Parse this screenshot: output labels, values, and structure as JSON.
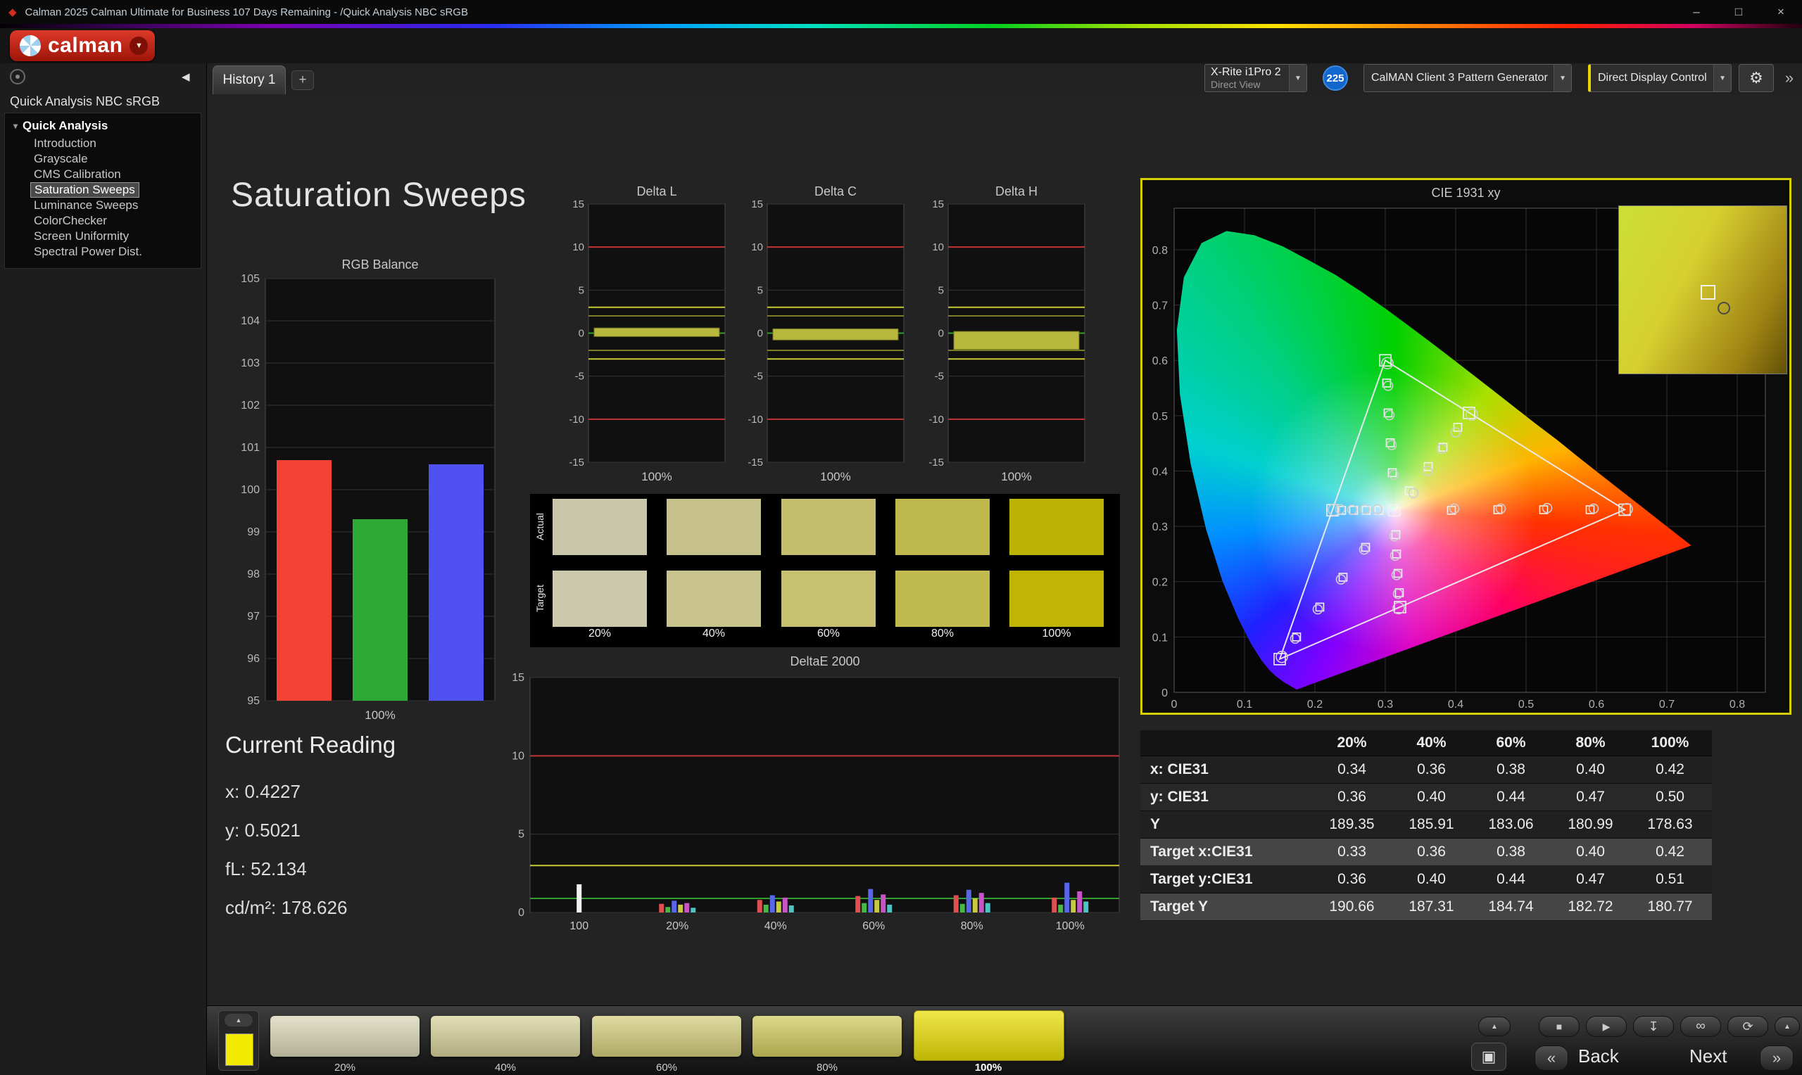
{
  "titlebar": {
    "title": "Calman 2025 Calman Ultimate for Business 107 Days Remaining  - /Quick Analysis NBC sRGB"
  },
  "icons": {
    "app": "◆",
    "minimize": "–",
    "maximize": "□",
    "close": "×",
    "dropdown": "▼",
    "plus": "+",
    "collapse_left": "◀",
    "expand_arrow": "▾",
    "gear": "⚙",
    "double_chevron_right": "»",
    "up_chevron": "▲",
    "stop": "■",
    "play": "▶",
    "save": "↧",
    "infinity": "∞",
    "loop": "⟳",
    "pip": "▣",
    "back_chevron": "«",
    "next_chevron": "»"
  },
  "chrome": {
    "logo_text": "calman",
    "tab": "History 1",
    "meter": {
      "line1": "X-Rite i1Pro 2",
      "line2": "Direct View"
    },
    "badge": "225",
    "generator": "CalMAN Client 3 Pattern Generator",
    "display_control": "Direct Display Control"
  },
  "sidebar": {
    "header": "Quick Analysis NBC sRGB",
    "root": "Quick Analysis",
    "selected": "Saturation Sweeps",
    "items": [
      "Introduction",
      "Grayscale",
      "CMS Calibration",
      "Saturation Sweeps",
      "Luminance Sweeps",
      "ColorChecker",
      "Screen Uniformity",
      "Spectral Power Dist."
    ]
  },
  "page": {
    "title": "Saturation Sweeps"
  },
  "current_reading": {
    "title": "Current Reading",
    "lines": [
      "x: 0.4227",
      "y: 0.5021",
      "fL: 52.134",
      "cd/m²: 178.626"
    ]
  },
  "swatch_table": {
    "row_labels": [
      "Actual",
      "Target"
    ],
    "col_labels": [
      "20%",
      "40%",
      "60%",
      "80%",
      "100%"
    ],
    "actual_colors": [
      "#c9c6a9",
      "#c7c28c",
      "#c4be6e",
      "#bfb84c",
      "#bdb306"
    ],
    "target_colors": [
      "#cbc8ab",
      "#c9c48e",
      "#c6c070",
      "#c1ba4e",
      "#c0b505"
    ]
  },
  "results_table": {
    "col_headers": [
      "20%",
      "40%",
      "60%",
      "80%",
      "100%"
    ],
    "row_colors": [
      "#202020",
      "#282828",
      "#202020",
      "#454545",
      "#202020",
      "#454545"
    ],
    "rows": [
      {
        "label": "x: CIE31",
        "values": [
          "0.34",
          "0.36",
          "0.38",
          "0.40",
          "0.42"
        ]
      },
      {
        "label": "y: CIE31",
        "values": [
          "0.36",
          "0.40",
          "0.44",
          "0.47",
          "0.50"
        ]
      },
      {
        "label": "Y",
        "values": [
          "189.35",
          "185.91",
          "183.06",
          "180.99",
          "178.63"
        ]
      },
      {
        "label": "Target x:CIE31",
        "values": [
          "0.33",
          "0.36",
          "0.38",
          "0.40",
          "0.42"
        ]
      },
      {
        "label": "Target y:CIE31",
        "values": [
          "0.36",
          "0.40",
          "0.44",
          "0.47",
          "0.51"
        ]
      },
      {
        "label": "Target Y",
        "values": [
          "190.66",
          "187.31",
          "184.74",
          "182.72",
          "180.77"
        ]
      }
    ]
  },
  "bottom_bar": {
    "back": "Back",
    "next": "Next",
    "mini_swatch_color": "#f2ea00",
    "swatches": [
      {
        "label": "20%",
        "color": "#d9d6b6",
        "selected": false
      },
      {
        "label": "40%",
        "color": "#d7d29b",
        "selected": false
      },
      {
        "label": "60%",
        "color": "#d4ce7d",
        "selected": false
      },
      {
        "label": "80%",
        "color": "#d1ca5d",
        "selected": false
      },
      {
        "label": "100%",
        "color": "#e9dd05",
        "selected": true
      }
    ]
  },
  "chart_data": [
    {
      "id": "rgb_balance",
      "type": "bar",
      "title": "RGB Balance",
      "categories": [
        "Red",
        "Green",
        "Blue"
      ],
      "values": [
        100.7,
        99.3,
        100.6
      ],
      "colors": [
        "#f44336",
        "#2daa35",
        "#4f52f0"
      ],
      "ylim": [
        95,
        105
      ],
      "xlabel": "100%"
    },
    {
      "id": "delta_l",
      "type": "bar",
      "title": "Delta L",
      "xlabel": "100%",
      "ylim": [
        -15,
        15
      ],
      "bar": [
        0.6,
        -0.4
      ],
      "bar_color": "#b8b83e",
      "ref_lines": [
        [
          10,
          "#c23535"
        ],
        [
          -10,
          "#c23535"
        ],
        [
          3,
          "#c9c938"
        ],
        [
          -3,
          "#c9c938"
        ],
        [
          2,
          "#7d7d26"
        ],
        [
          -2,
          "#7d7d26"
        ],
        [
          0,
          "#2f9f2f"
        ]
      ]
    },
    {
      "id": "delta_c",
      "type": "bar",
      "title": "Delta C",
      "xlabel": "100%",
      "ylim": [
        -15,
        15
      ],
      "bar": [
        0.5,
        -0.8
      ],
      "bar_color": "#b8b83e",
      "ref_lines": [
        [
          10,
          "#c23535"
        ],
        [
          -10,
          "#c23535"
        ],
        [
          3,
          "#c9c938"
        ],
        [
          -3,
          "#c9c938"
        ],
        [
          2,
          "#7d7d26"
        ],
        [
          -2,
          "#7d7d26"
        ],
        [
          0,
          "#2f9f2f"
        ]
      ]
    },
    {
      "id": "delta_h",
      "type": "bar",
      "title": "Delta H",
      "xlabel": "100%",
      "ylim": [
        -15,
        15
      ],
      "bar": [
        0.2,
        -1.9
      ],
      "bar_color": "#b8b83e",
      "ref_lines": [
        [
          10,
          "#c23535"
        ],
        [
          -10,
          "#c23535"
        ],
        [
          3,
          "#c9c938"
        ],
        [
          -3,
          "#c9c938"
        ],
        [
          2,
          "#7d7d26"
        ],
        [
          -2,
          "#7d7d26"
        ],
        [
          0,
          "#2f9f2f"
        ]
      ]
    },
    {
      "id": "deltae",
      "type": "bar",
      "title": "DeltaE 2000",
      "ylim": [
        0,
        15
      ],
      "yticks": [
        0,
        5,
        10,
        15
      ],
      "ref_lines": [
        [
          10,
          "#c23535"
        ],
        [
          3,
          "#c9c938"
        ],
        [
          0.9,
          "#2f9f2f"
        ]
      ],
      "groups": [
        {
          "label": "100",
          "bars": [
            [
              "#f2f2f2",
              1.8
            ]
          ]
        },
        {
          "label": "20%",
          "bars": [
            [
              "#e05050",
              0.55
            ],
            [
              "#46b846",
              0.35
            ],
            [
              "#5866e8",
              0.75
            ],
            [
              "#c9c93f",
              0.5
            ],
            [
              "#c855c8",
              0.6
            ],
            [
              "#4fc3c3",
              0.3
            ]
          ]
        },
        {
          "label": "40%",
          "bars": [
            [
              "#e05050",
              0.8
            ],
            [
              "#46b846",
              0.5
            ],
            [
              "#5866e8",
              1.1
            ],
            [
              "#c9c93f",
              0.7
            ],
            [
              "#c855c8",
              0.95
            ],
            [
              "#4fc3c3",
              0.45
            ]
          ]
        },
        {
          "label": "60%",
          "bars": [
            [
              "#e05050",
              1.05
            ],
            [
              "#46b846",
              0.6
            ],
            [
              "#5866e8",
              1.5
            ],
            [
              "#c9c93f",
              0.8
            ],
            [
              "#c855c8",
              1.15
            ],
            [
              "#4fc3c3",
              0.5
            ]
          ]
        },
        {
          "label": "80%",
          "bars": [
            [
              "#e05050",
              1.1
            ],
            [
              "#46b846",
              0.55
            ],
            [
              "#5866e8",
              1.45
            ],
            [
              "#c9c93f",
              0.9
            ],
            [
              "#c855c8",
              1.25
            ],
            [
              "#4fc3c3",
              0.6
            ]
          ]
        },
        {
          "label": "100%",
          "bars": [
            [
              "#e05050",
              0.95
            ],
            [
              "#46b846",
              0.5
            ],
            [
              "#5866e8",
              1.9
            ],
            [
              "#c9c93f",
              0.8
            ],
            [
              "#c855c8",
              1.35
            ],
            [
              "#4fc3c3",
              0.7
            ]
          ]
        }
      ]
    },
    {
      "id": "cie",
      "type": "scatter",
      "title": "CIE 1931 xy",
      "xlim": [
        0,
        0.84
      ],
      "ylim": [
        0,
        0.875
      ],
      "xticks": [
        0,
        0.1,
        0.2,
        0.3,
        0.4,
        0.5,
        0.6,
        0.7,
        0.8
      ],
      "yticks": [
        0,
        0.1,
        0.2,
        0.3,
        0.4,
        0.5,
        0.6,
        0.7,
        0.8
      ],
      "white_point": [
        0.3127,
        0.329
      ],
      "gamut_triangle": [
        [
          0.64,
          0.33
        ],
        [
          0.3,
          0.6
        ],
        [
          0.15,
          0.06
        ]
      ],
      "locus": [
        [
          0.1741,
          0.005
        ],
        [
          0.1566,
          0.0177
        ],
        [
          0.144,
          0.0297
        ],
        [
          0.1355,
          0.0399
        ],
        [
          0.1241,
          0.0578
        ],
        [
          0.1096,
          0.0868
        ],
        [
          0.0913,
          0.1327
        ],
        [
          0.0687,
          0.2007
        ],
        [
          0.0454,
          0.295
        ],
        [
          0.0235,
          0.4127
        ],
        [
          0.0082,
          0.5384
        ],
        [
          0.0039,
          0.6548
        ],
        [
          0.0139,
          0.7502
        ],
        [
          0.0389,
          0.812
        ],
        [
          0.0743,
          0.8338
        ],
        [
          0.1142,
          0.8262
        ],
        [
          0.1547,
          0.8059
        ],
        [
          0.1903,
          0.7816
        ],
        [
          0.2296,
          0.7543
        ],
        [
          0.2658,
          0.7243
        ],
        [
          0.3016,
          0.6923
        ],
        [
          0.3373,
          0.6588
        ],
        [
          0.3731,
          0.6245
        ],
        [
          0.4087,
          0.5896
        ],
        [
          0.4441,
          0.5547
        ],
        [
          0.4788,
          0.5202
        ],
        [
          0.5125,
          0.4866
        ],
        [
          0.5448,
          0.4554
        ],
        [
          0.5752,
          0.4242
        ],
        [
          0.6029,
          0.3965
        ],
        [
          0.627,
          0.3725
        ],
        [
          0.6482,
          0.3514
        ],
        [
          0.6658,
          0.334
        ],
        [
          0.6915,
          0.3083
        ],
        [
          0.714,
          0.2859
        ],
        [
          0.7347,
          0.2653
        ]
      ],
      "sweeps": [
        {
          "name": "red",
          "targets": [
            [
              0.394,
              0.329
            ],
            [
              0.46,
              0.33
            ],
            [
              0.525,
              0.33
            ],
            [
              0.591,
              0.33
            ],
            [
              0.64,
              0.33
            ]
          ],
          "measured": [
            [
              0.398,
              0.332
            ],
            [
              0.464,
              0.332
            ],
            [
              0.53,
              0.333
            ],
            [
              0.596,
              0.332
            ],
            [
              0.643,
              0.331
            ]
          ]
        },
        {
          "name": "yellow",
          "targets": [
            [
              0.334,
              0.364
            ],
            [
              0.361,
              0.408
            ],
            [
              0.382,
              0.443
            ],
            [
              0.403,
              0.479
            ],
            [
              0.419,
              0.505
            ]
          ],
          "measured": [
            [
              0.34,
              0.36
            ],
            [
              0.36,
              0.4
            ],
            [
              0.38,
              0.44
            ],
            [
              0.4,
              0.47
            ],
            [
              0.423,
              0.502
            ]
          ]
        },
        {
          "name": "green",
          "targets": [
            [
              0.31,
              0.397
            ],
            [
              0.307,
              0.451
            ],
            [
              0.304,
              0.505
            ],
            [
              0.302,
              0.559
            ],
            [
              0.3,
              0.6
            ]
          ],
          "measured": [
            [
              0.312,
              0.393
            ],
            [
              0.309,
              0.447
            ],
            [
              0.306,
              0.501
            ],
            [
              0.304,
              0.554
            ],
            [
              0.303,
              0.595
            ]
          ]
        },
        {
          "name": "cyan",
          "targets": [
            [
              0.291,
              0.329
            ],
            [
              0.273,
              0.329
            ],
            [
              0.255,
              0.329
            ],
            [
              0.238,
              0.329
            ],
            [
              0.225,
              0.329
            ]
          ],
          "measured": [
            [
              0.289,
              0.331
            ],
            [
              0.271,
              0.331
            ],
            [
              0.253,
              0.33
            ],
            [
              0.236,
              0.331
            ],
            [
              0.227,
              0.33
            ]
          ]
        },
        {
          "name": "blue",
          "targets": [
            [
              0.272,
              0.262
            ],
            [
              0.24,
              0.208
            ],
            [
              0.207,
              0.154
            ],
            [
              0.174,
              0.1
            ],
            [
              0.15,
              0.06
            ]
          ],
          "measured": [
            [
              0.27,
              0.258
            ],
            [
              0.237,
              0.204
            ],
            [
              0.204,
              0.15
            ],
            [
              0.172,
              0.097
            ],
            [
              0.153,
              0.064
            ]
          ]
        },
        {
          "name": "magenta",
          "targets": [
            [
              0.315,
              0.285
            ],
            [
              0.316,
              0.25
            ],
            [
              0.318,
              0.215
            ],
            [
              0.32,
              0.18
            ],
            [
              0.321,
              0.154
            ]
          ],
          "measured": [
            [
              0.313,
              0.282
            ],
            [
              0.314,
              0.247
            ],
            [
              0.316,
              0.212
            ],
            [
              0.318,
              0.178
            ],
            [
              0.319,
              0.152
            ]
          ]
        }
      ]
    }
  ]
}
